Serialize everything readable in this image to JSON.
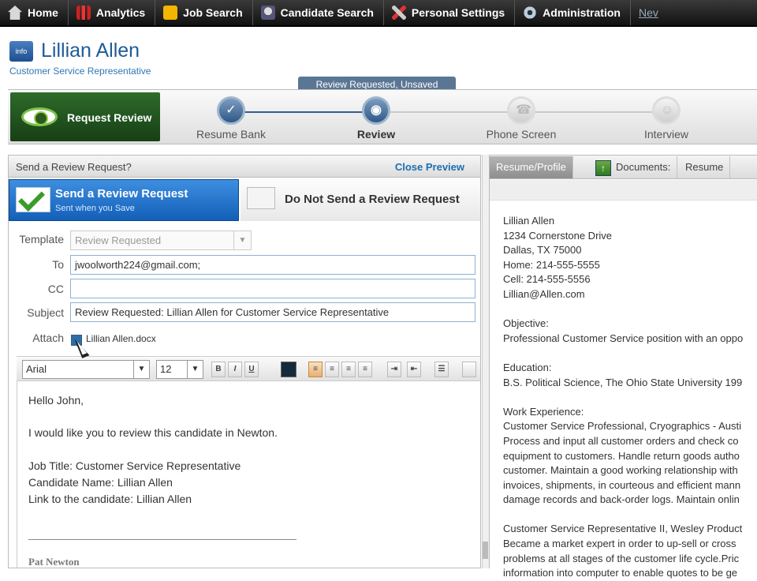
{
  "nav": {
    "items": [
      {
        "label": "Home",
        "icon": "home-icon"
      },
      {
        "label": "Analytics",
        "icon": "analytics-icon"
      },
      {
        "label": "Job Search",
        "icon": "job-search-icon"
      },
      {
        "label": "Candidate Search",
        "icon": "candidate-search-icon"
      },
      {
        "label": "Personal Settings",
        "icon": "personal-settings-icon"
      },
      {
        "label": "Administration",
        "icon": "administration-icon"
      }
    ],
    "overflow_label": "Nev"
  },
  "candidate": {
    "badge": "info",
    "name": "Lillian Allen",
    "title": "Customer Service Representative"
  },
  "status": "Review Requested, Unsaved",
  "workflow": {
    "action_label": "Request Review",
    "steps": [
      {
        "label": "Resume Bank",
        "state": "done"
      },
      {
        "label": "Review",
        "state": "active"
      },
      {
        "label": "Phone Screen",
        "state": "pending"
      },
      {
        "label": "Interview",
        "state": "pending"
      }
    ]
  },
  "review_panel": {
    "heading": "Send a Review Request?",
    "close_label": "Close Preview",
    "send_option": {
      "title": "Send a Review Request",
      "subtitle": "Sent when you Save"
    },
    "no_send_option": {
      "title": "Do Not Send a Review Request"
    },
    "form": {
      "template_label": "Template",
      "template_value": "Review Requested",
      "to_label": "To",
      "to_value": "jwoolworth224@gmail.com;",
      "cc_label": "CC",
      "cc_value": "",
      "subject_label": "Subject",
      "subject_value": "Review Requested: Lillian Allen for Customer Service Representative",
      "attach_label": "Attach",
      "attach_file": "Lillian Allen.docx",
      "attach_checked": true
    },
    "toolbar": {
      "font": "Arial",
      "size": "12",
      "bold": "B",
      "italic": "I",
      "underline": "U"
    },
    "body": {
      "greeting": "Hello John,",
      "line1": "I would like you to review this candidate in Newton.",
      "job_title": "Job Title: Customer Service Representative",
      "candidate_name": "Candidate Name: Lillian Allen",
      "link": "Link to the candidate: Lillian Allen",
      "signature": "Pat Newton"
    }
  },
  "resume_panel": {
    "tabs": {
      "profile": "Resume/Profile",
      "documents": "Documents:",
      "resume": "Resume"
    },
    "lines": {
      "name": "Lillian Allen",
      "addr1": "1234 Cornerstone Drive",
      "addr2": "Dallas, TX 75000",
      "home": "Home: 214-555-5555",
      "cell": "Cell: 214-555-5556",
      "email": "Lillian@Allen.com",
      "objective_h": "Objective:",
      "objective": "Professional Customer Service position with an oppo",
      "education_h": "Education:",
      "education": "B.S. Political Science, The Ohio State University 199",
      "work_h": "Work Experience:",
      "work1": "Customer Service Professional, Cryographics - Austi",
      "work2": "Process and input all customer orders and check co",
      "work3": "equipment to customers. Handle return goods autho",
      "work4": "customer. Maintain a good working relationship with",
      "work5": "invoices, shipments, in courteous and efficient mann",
      "work6": "damage records and back-order logs. Maintain onlin",
      "work7": "Customer Service Representative II, Wesley Product",
      "work8": "Became a market expert in order to up-sell or cross",
      "work9": "problems at all stages of the customer life cycle.Pric",
      "work10": "information into computer to enable quotes to be ge"
    }
  },
  "colors": {
    "nav_bg": "#1a1a1a",
    "accent_blue": "#1e5c96",
    "send_blue": "#135fb8",
    "review_green": "#1f4f1c"
  }
}
